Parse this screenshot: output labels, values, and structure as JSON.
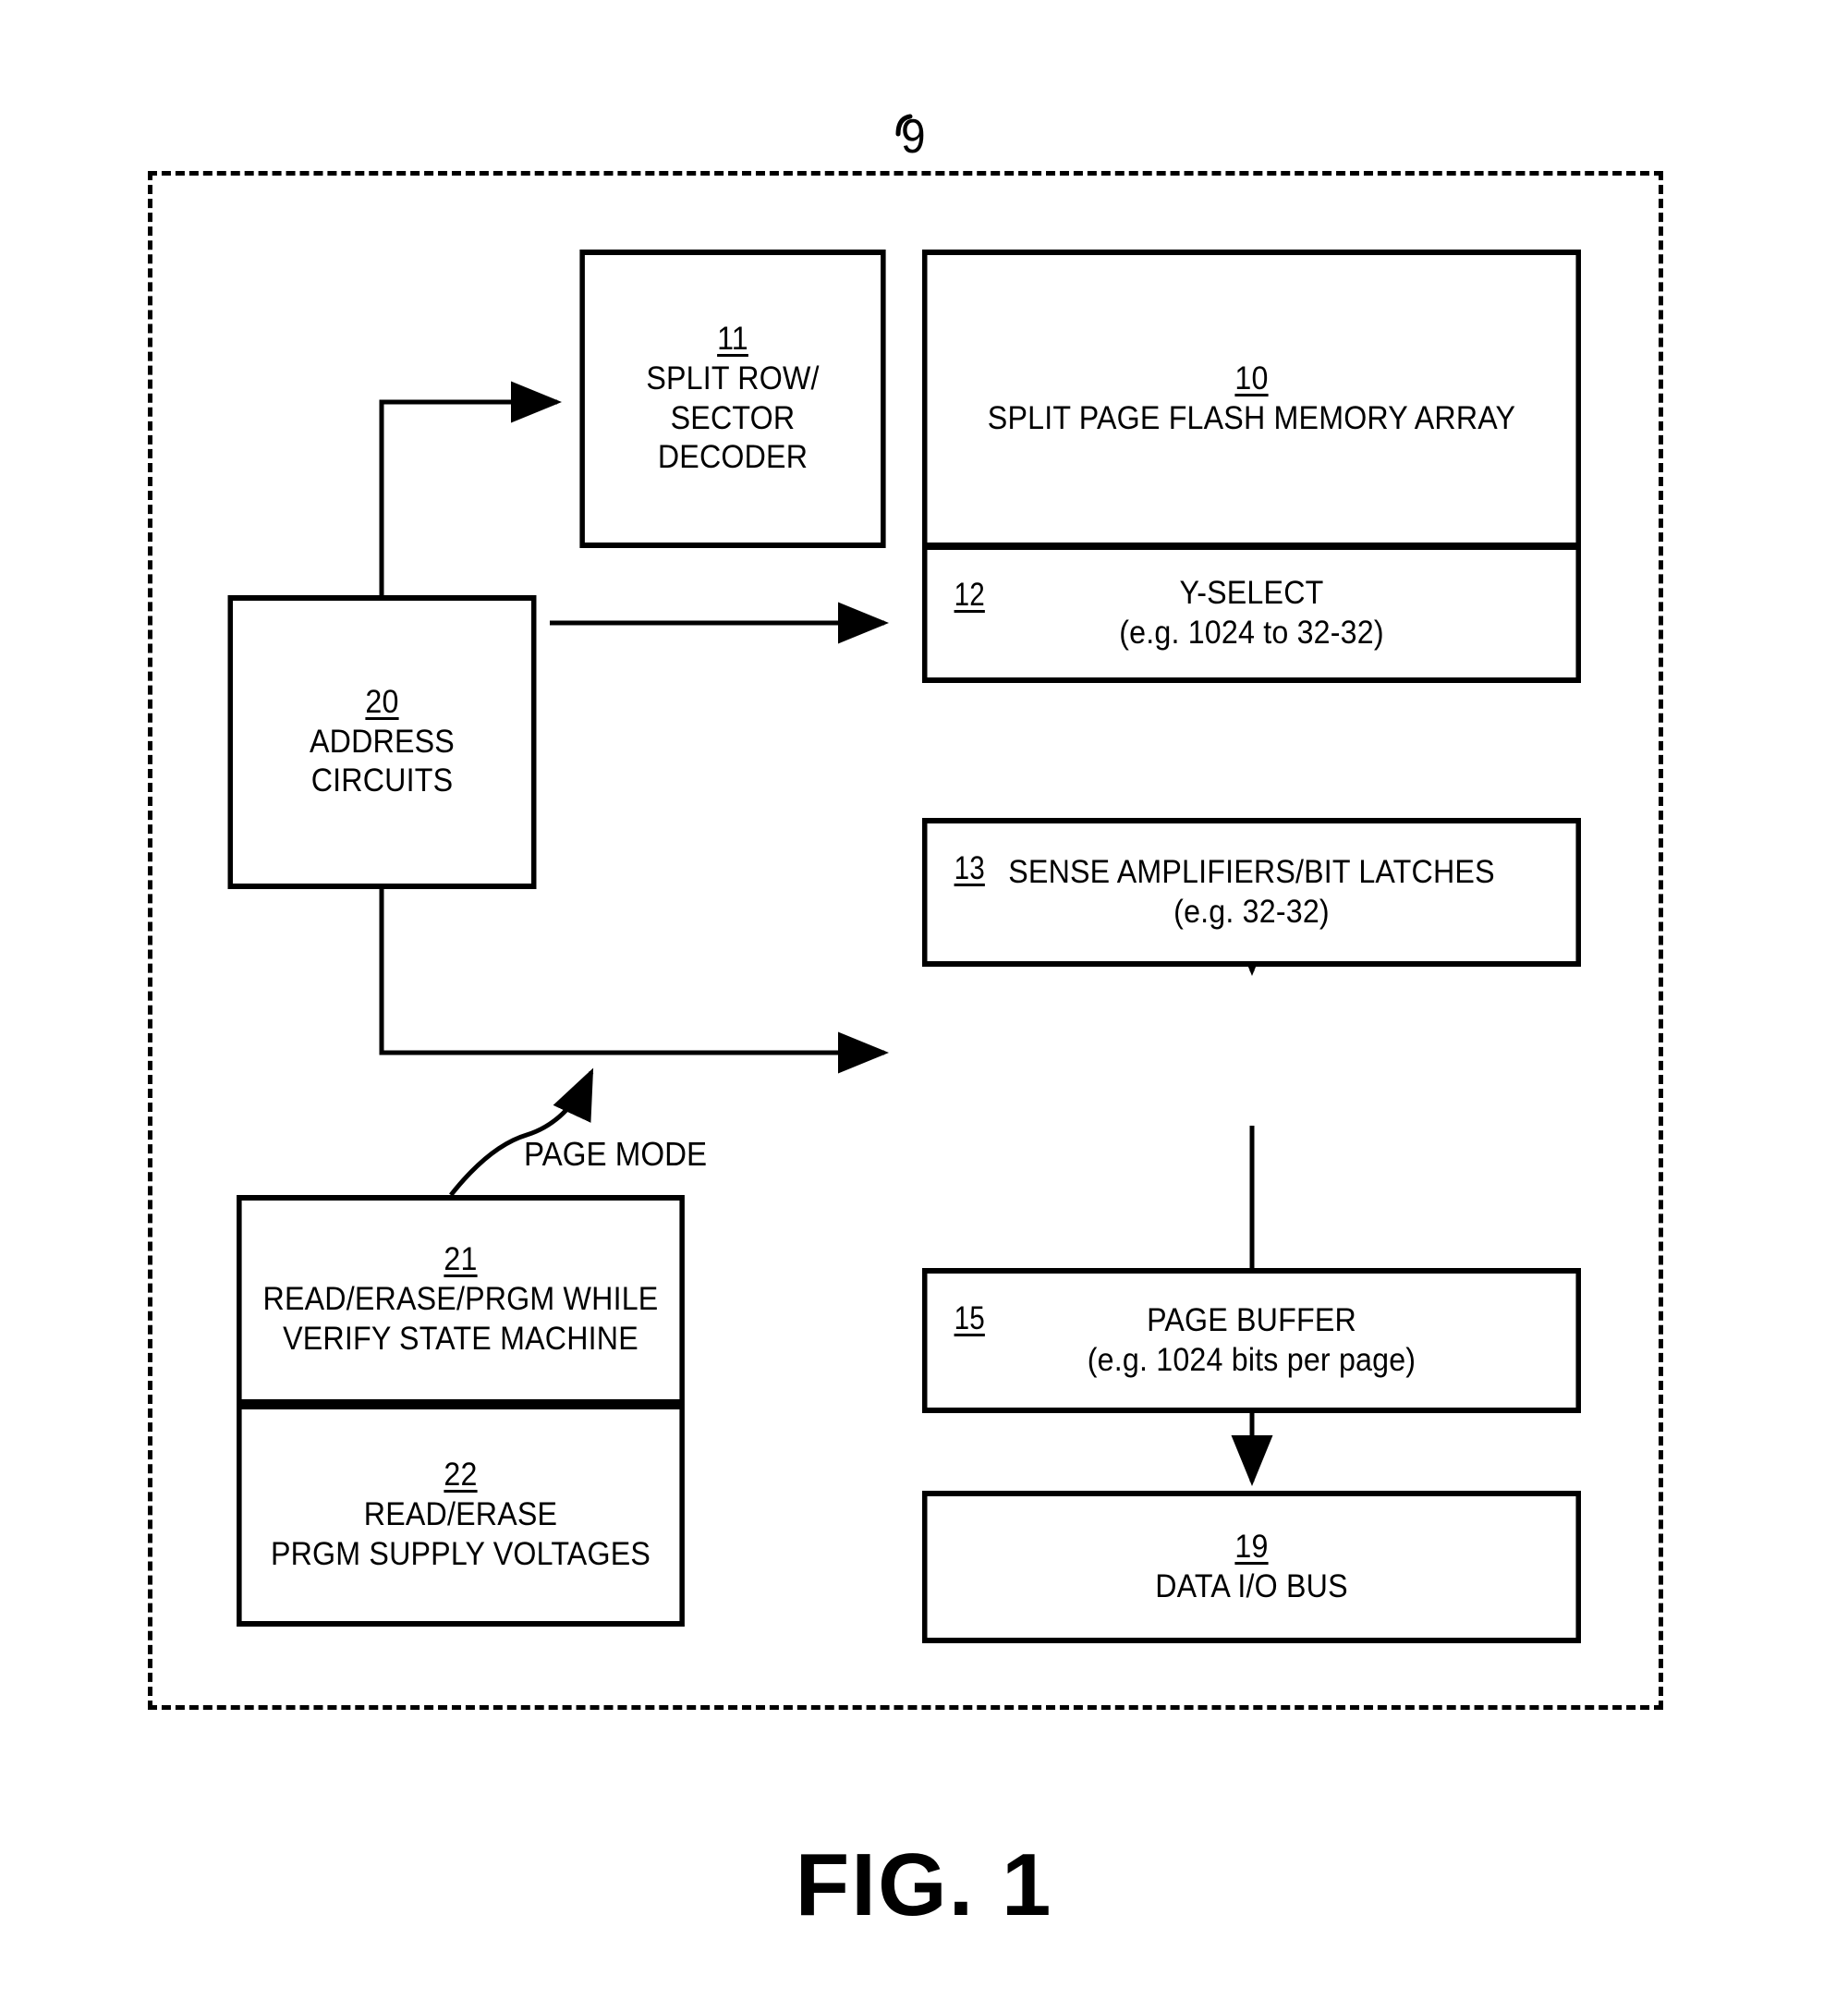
{
  "figure": {
    "caption": "FIG. 1",
    "chip_ref": "9"
  },
  "blocks": {
    "split_row_sector_decoder": {
      "ref": "11",
      "line1": "SPLIT ROW/",
      "line2": "SECTOR",
      "line3": "DECODER"
    },
    "split_page_flash_memory_array": {
      "ref": "10",
      "line1": "SPLIT PAGE FLASH MEMORY ARRAY"
    },
    "y_select": {
      "ref": "12",
      "line1": "Y-SELECT",
      "line2": "(e.g. 1024 to 32-32)"
    },
    "sense_amplifiers": {
      "ref": "13",
      "line1": "SENSE AMPLIFIERS/BIT LATCHES",
      "line2": "(e.g. 32-32)"
    },
    "address_circuits": {
      "ref": "20",
      "line1": "ADDRESS",
      "line2": "CIRCUITS"
    },
    "page_buffer": {
      "ref": "15",
      "line1": "PAGE BUFFER",
      "line2": "(e.g. 1024 bits per page)"
    },
    "data_io_bus": {
      "ref": "19",
      "line1": "DATA I/O BUS"
    },
    "state_machine": {
      "ref": "21",
      "line1": "READ/ERASE/PRGM WHILE",
      "line2": "VERIFY STATE MACHINE"
    },
    "supply_voltages": {
      "ref": "22",
      "line1": "READ/ERASE",
      "line2": "PRGM SUPPLY VOLTAGES"
    }
  },
  "annotations": {
    "page_mode": "PAGE MODE"
  },
  "colors": {
    "line": "#000000",
    "background": "#ffffff"
  }
}
